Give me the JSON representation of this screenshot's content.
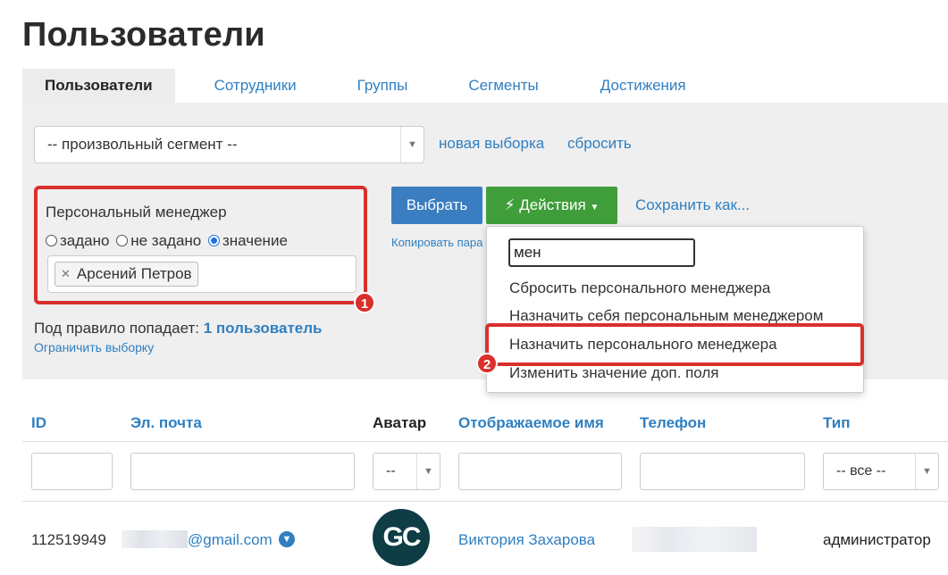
{
  "page": {
    "title": "Пользователи"
  },
  "tabs": [
    {
      "label": "Пользователи",
      "active": true
    },
    {
      "label": "Сотрудники"
    },
    {
      "label": "Группы"
    },
    {
      "label": "Сегменты"
    },
    {
      "label": "Достижения"
    }
  ],
  "segment": {
    "selected": "-- произвольный сегмент --",
    "new_selection_link": "новая выборка",
    "reset_link": "сбросить"
  },
  "filter": {
    "title": "Персональный менеджер",
    "options": {
      "set": "задано",
      "not_set": "не задано",
      "value": "значение"
    },
    "selected_option": "value",
    "tag": "Арсений Петров",
    "badge": "1"
  },
  "toolbar": {
    "select_button": "Выбрать",
    "actions_button": "Действия",
    "save_as_link": "Сохранить как...",
    "copy_params_link": "Копировать пара"
  },
  "result": {
    "prefix": "Под правило попадает:",
    "count_link": "1 пользователь",
    "limit_link": "Ограничить выборку"
  },
  "actions_menu": {
    "search_value": "мен",
    "items": [
      "Сбросить персонального менеджера",
      "Назначить себя персональным менеджером",
      "Назначить персонального менеджера",
      "Изменить значение доп. поля"
    ],
    "badge": "2"
  },
  "table": {
    "headers": {
      "id": "ID",
      "email": "Эл. почта",
      "avatar": "Аватар",
      "name": "Отображаемое имя",
      "phone": "Телефон",
      "type": "Тип"
    },
    "filters": {
      "avatar_select": "--",
      "type_select": "-- все --"
    },
    "rows": [
      {
        "id": "112519949",
        "email": "@gmail.com",
        "avatar_initials": "GC",
        "name": "Виктория Захарова",
        "type": "администратор"
      }
    ]
  },
  "colors": {
    "accent_blue": "#2f7fc1",
    "btn_blue": "#3a7dc0",
    "btn_green": "#3f9e3a",
    "highlight_red": "#d9302c",
    "avatar_bg": "#0e3d45",
    "avatar_fg": "#3fc0a0"
  }
}
